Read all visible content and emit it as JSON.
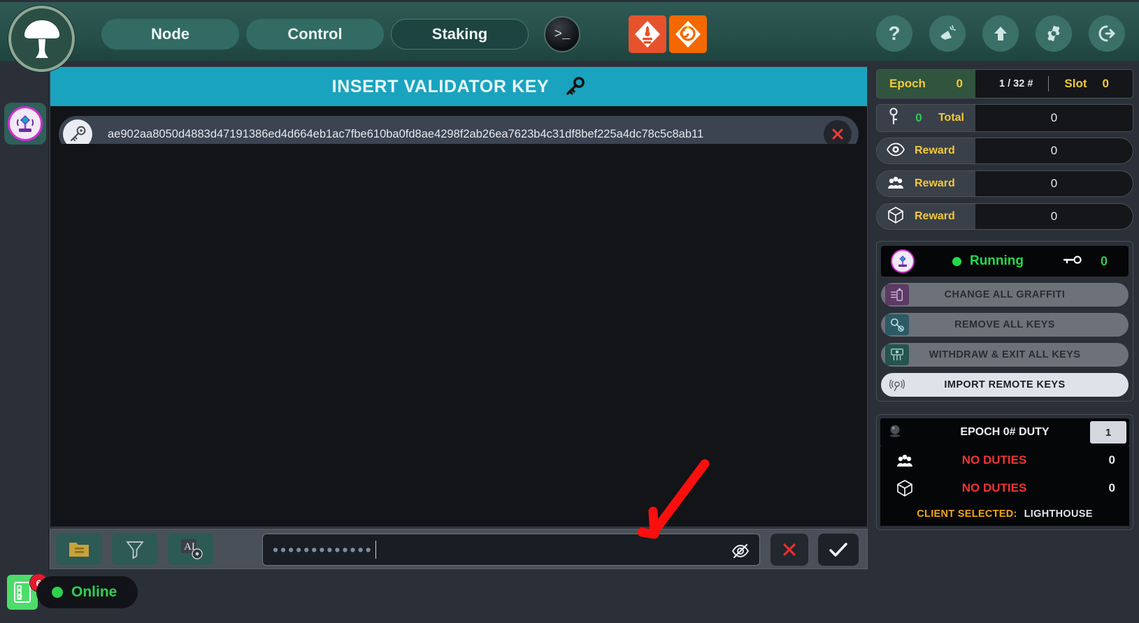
{
  "app": {
    "logo_icon": "mushroom-logo-icon"
  },
  "topnav": {
    "tabs": [
      {
        "label": "Node",
        "active": false
      },
      {
        "label": "Control",
        "active": false
      },
      {
        "label": "Staking",
        "active": true
      }
    ],
    "terminal_icon": "terminal-prompt-icon",
    "brand_icons": [
      {
        "name": "prometheus-icon",
        "color": "#e6522c"
      },
      {
        "name": "grafana-icon",
        "color": "#f46800"
      }
    ],
    "right_icons": [
      {
        "name": "help-icon",
        "glyph": "?"
      },
      {
        "name": "megaphone-icon",
        "glyph": ""
      },
      {
        "name": "upload-arrow-icon",
        "glyph": ""
      },
      {
        "name": "settings-gear-icon",
        "glyph": ""
      },
      {
        "name": "logout-icon",
        "glyph": ""
      }
    ]
  },
  "leftrail": {
    "items": [
      {
        "name": "validator-client-icon",
        "label": "Validator Client"
      }
    ]
  },
  "main": {
    "title": "INSERT VALIDATOR KEY",
    "title_icon": "key-icon",
    "key_entry": {
      "icon": "key-icon",
      "value": "ae902aa8050d4883d47191386ed4d664eb1ac7fbe610ba0fd8ae4298f2ab26ea7623b4c31df8bef225a4dc78c5c8ab11",
      "delete_icon": "close-x-icon"
    }
  },
  "bottom_toolbar": {
    "buttons": [
      {
        "name": "open-folder-button",
        "icon": "folder-icon"
      },
      {
        "name": "filter-button",
        "icon": "funnel-filter-icon"
      },
      {
        "name": "ai-detect-button",
        "icon": "ai-text-icon",
        "label": "AI"
      }
    ],
    "password": {
      "value": "•••••••••••••",
      "placeholder": "",
      "masked": true,
      "toggle_icon": "eye-off-icon"
    },
    "cancel_icon": "red-x-icon",
    "confirm_icon": "checkmark-icon"
  },
  "sidebar": {
    "epoch": {
      "label": "Epoch",
      "value": "0",
      "fraction": "1 / 32 #",
      "slot_label": "Slot",
      "slot_value": "0"
    },
    "total": {
      "key_icon": "key-icon",
      "key_count": "0",
      "label": "Total",
      "value": "0"
    },
    "rewards": [
      {
        "icon": "eye-attestation-icon",
        "label": "Reward",
        "value": "0"
      },
      {
        "icon": "committee-sync-icon",
        "label": "Reward",
        "value": "0"
      },
      {
        "icon": "block-cube-icon",
        "label": "Reward",
        "value": "0"
      }
    ],
    "validator_client": {
      "icon": "validator-client-icon",
      "status": "Running",
      "status_color": "#25d94a",
      "key_icon": "key-icon",
      "key_count": "0",
      "actions": [
        {
          "name": "change-all-graffiti-button",
          "label": "CHANGE ALL GRAFFITI",
          "icon": "spray-can-icon",
          "style": "dim"
        },
        {
          "name": "remove-all-keys-button",
          "label": "REMOVE ALL KEYS",
          "icon": "key-remove-icon",
          "style": "dim"
        },
        {
          "name": "withdraw-exit-all-keys-button",
          "label": "WITHDRAW & EXIT ALL KEYS",
          "icon": "withdraw-hand-icon",
          "style": "dim"
        },
        {
          "name": "import-remote-keys-button",
          "label": "IMPORT REMOTE KEYS",
          "icon": "remote-signal-icon",
          "style": "light"
        }
      ]
    },
    "duty": {
      "icon": "crystal-ball-icon",
      "header": "EPOCH 0# DUTY",
      "count": "1",
      "rows": [
        {
          "icon": "committee-sync-icon",
          "text": "NO DUTIES",
          "value": "0"
        },
        {
          "icon": "block-cube-icon",
          "text": "NO DUTIES",
          "value": "0"
        }
      ],
      "client_label": "CLIENT SELECTED:",
      "client_value": "LIGHTHOUSE"
    }
  },
  "statusbar": {
    "checklist_icon": "checklist-icon",
    "badge_count": "6",
    "status_text": "Online",
    "status_color": "#2fd14e"
  },
  "annotation": {
    "arrow_color": "#fa0f0f",
    "arrow_target": "password-input"
  },
  "colors": {
    "accent_teal": "#1aa3be",
    "nav_green": "#316b64",
    "gold": "#f2c938",
    "danger_red": "#f03434",
    "success_green": "#2fd14e"
  }
}
